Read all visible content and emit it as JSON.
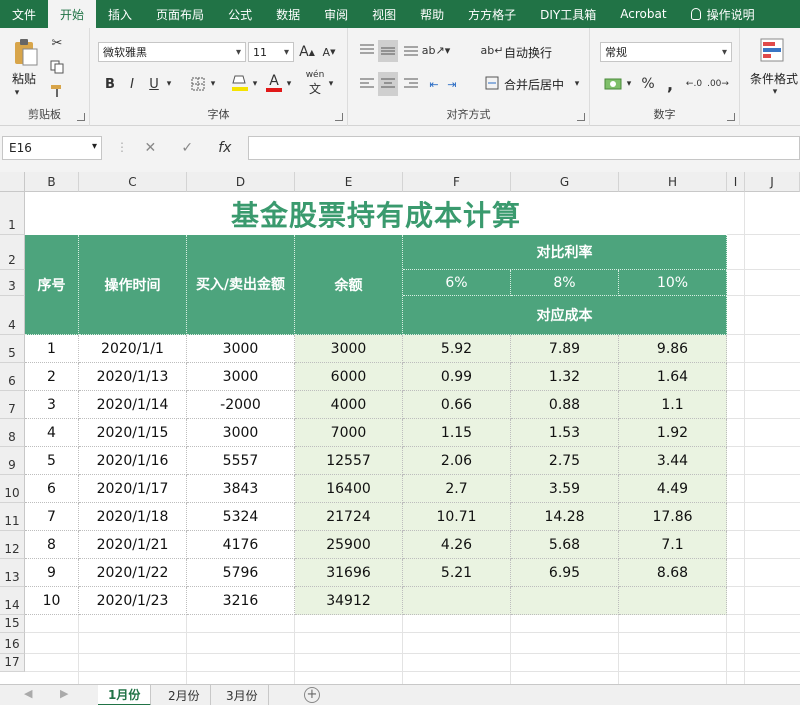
{
  "ribbon_tabs": [
    {
      "label": "文件",
      "active": false
    },
    {
      "label": "开始",
      "active": true
    },
    {
      "label": "插入",
      "active": false
    },
    {
      "label": "页面布局",
      "active": false
    },
    {
      "label": "公式",
      "active": false
    },
    {
      "label": "数据",
      "active": false
    },
    {
      "label": "审阅",
      "active": false
    },
    {
      "label": "视图",
      "active": false
    },
    {
      "label": "帮助",
      "active": false
    },
    {
      "label": "方方格子",
      "active": false
    },
    {
      "label": "DIY工具箱",
      "active": false
    },
    {
      "label": "Acrobat",
      "active": false
    }
  ],
  "tell_me": "操作说明",
  "clipboard": {
    "group_label": "剪贴板",
    "paste_label": "粘贴"
  },
  "font": {
    "group_label": "字体",
    "family": "微软雅黑",
    "size": "11",
    "bold": "B",
    "italic": "I",
    "underline": "U",
    "grow": "A",
    "shrink": "A",
    "color_glyph": "A",
    "wen": "wén"
  },
  "alignment": {
    "group_label": "对齐方式",
    "wrap_label": "自动换行",
    "merge_label": "合并后居中"
  },
  "number": {
    "group_label": "数字",
    "format": "常规",
    "percent": "%",
    "comma": ","
  },
  "styles": {
    "conditional_label": "条件格式"
  },
  "formula_bar": {
    "name_box": "E16",
    "fx": "fx",
    "cancel": "✕",
    "enter": "✓",
    "content": ""
  },
  "columns": [
    "B",
    "C",
    "D",
    "E",
    "F",
    "G",
    "H",
    "I",
    "J"
  ],
  "rows": [
    "1",
    "2",
    "3",
    "4",
    "5",
    "6",
    "7",
    "8",
    "9",
    "10",
    "11",
    "12",
    "13",
    "14",
    "15",
    "16",
    "17"
  ],
  "sheet": {
    "title": "基金股票持有成本计算",
    "headers": {
      "no": "序号",
      "time": "操作时间",
      "trade": "买入/卖出金额",
      "balance": "余额",
      "compare": "对比利率",
      "rate1": "6%",
      "rate2": "8%",
      "rate3": "10%",
      "cost": "对应成本"
    },
    "rows": [
      {
        "no": "1",
        "date": "2020/1/1",
        "amount": "3000",
        "balance": "3000",
        "c6": "5.92",
        "c8": "7.89",
        "c10": "9.86"
      },
      {
        "no": "2",
        "date": "2020/1/13",
        "amount": "3000",
        "balance": "6000",
        "c6": "0.99",
        "c8": "1.32",
        "c10": "1.64"
      },
      {
        "no": "3",
        "date": "2020/1/14",
        "amount": "-2000",
        "balance": "4000",
        "c6": "0.66",
        "c8": "0.88",
        "c10": "1.1"
      },
      {
        "no": "4",
        "date": "2020/1/15",
        "amount": "3000",
        "balance": "7000",
        "c6": "1.15",
        "c8": "1.53",
        "c10": "1.92"
      },
      {
        "no": "5",
        "date": "2020/1/16",
        "amount": "5557",
        "balance": "12557",
        "c6": "2.06",
        "c8": "2.75",
        "c10": "3.44"
      },
      {
        "no": "6",
        "date": "2020/1/17",
        "amount": "3843",
        "balance": "16400",
        "c6": "2.7",
        "c8": "3.59",
        "c10": "4.49"
      },
      {
        "no": "7",
        "date": "2020/1/18",
        "amount": "5324",
        "balance": "21724",
        "c6": "10.71",
        "c8": "14.28",
        "c10": "17.86"
      },
      {
        "no": "8",
        "date": "2020/1/21",
        "amount": "4176",
        "balance": "25900",
        "c6": "4.26",
        "c8": "5.68",
        "c10": "7.1"
      },
      {
        "no": "9",
        "date": "2020/1/22",
        "amount": "5796",
        "balance": "31696",
        "c6": "5.21",
        "c8": "6.95",
        "c10": "8.68"
      },
      {
        "no": "10",
        "date": "2020/1/23",
        "amount": "3216",
        "balance": "34912",
        "c6": "",
        "c8": "",
        "c10": ""
      }
    ]
  },
  "sheet_tabs": [
    {
      "label": "1月份",
      "active": true
    },
    {
      "label": "2月份",
      "active": false
    },
    {
      "label": "3月份",
      "active": false
    }
  ],
  "colors": {
    "ribbon": "#217346",
    "header_fill": "#4da47d",
    "data_fill": "#eaf3e1",
    "title": "#3a9a6e"
  }
}
